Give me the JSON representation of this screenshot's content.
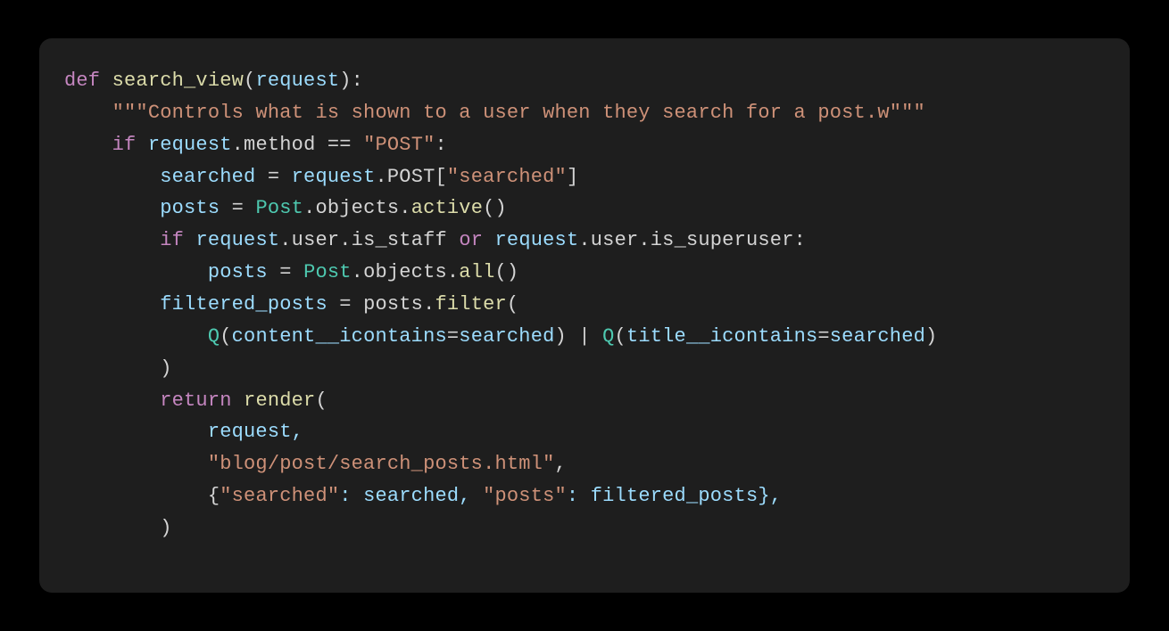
{
  "code": {
    "language": "python",
    "theme": "dark-plus",
    "tokens": [
      [
        {
          "t": "def ",
          "c": "kw"
        },
        {
          "t": "search_view",
          "c": "fn"
        },
        {
          "t": "(",
          "c": "pn"
        },
        {
          "t": "request",
          "c": "par"
        },
        {
          "t": "):",
          "c": "pn"
        }
      ],
      [
        {
          "t": "    ",
          "c": "pn"
        },
        {
          "t": "\"\"\"Controls what is shown to a user when they search for a post.w\"\"\"",
          "c": "str"
        }
      ],
      [
        {
          "t": "    ",
          "c": "pn"
        },
        {
          "t": "if ",
          "c": "kw"
        },
        {
          "t": "request",
          "c": "par"
        },
        {
          "t": ".method ",
          "c": "prop"
        },
        {
          "t": "== ",
          "c": "op"
        },
        {
          "t": "\"POST\"",
          "c": "str"
        },
        {
          "t": ":",
          "c": "pn"
        }
      ],
      [
        {
          "t": "        searched ",
          "c": "par"
        },
        {
          "t": "= ",
          "c": "op"
        },
        {
          "t": "request",
          "c": "par"
        },
        {
          "t": ".POST[",
          "c": "prop"
        },
        {
          "t": "\"searched\"",
          "c": "str"
        },
        {
          "t": "]",
          "c": "pn"
        }
      ],
      [
        {
          "t": "        posts ",
          "c": "par"
        },
        {
          "t": "= ",
          "c": "op"
        },
        {
          "t": "Post",
          "c": "cls"
        },
        {
          "t": ".objects.",
          "c": "prop"
        },
        {
          "t": "active",
          "c": "fn"
        },
        {
          "t": "()",
          "c": "pn"
        }
      ],
      [
        {
          "t": "        ",
          "c": "pn"
        },
        {
          "t": "if ",
          "c": "kw"
        },
        {
          "t": "request",
          "c": "par"
        },
        {
          "t": ".user.is_staff ",
          "c": "prop"
        },
        {
          "t": "or ",
          "c": "kw"
        },
        {
          "t": "request",
          "c": "par"
        },
        {
          "t": ".user.is_superuser:",
          "c": "prop"
        }
      ],
      [
        {
          "t": "            posts ",
          "c": "par"
        },
        {
          "t": "= ",
          "c": "op"
        },
        {
          "t": "Post",
          "c": "cls"
        },
        {
          "t": ".objects.",
          "c": "prop"
        },
        {
          "t": "all",
          "c": "fn"
        },
        {
          "t": "()",
          "c": "pn"
        }
      ],
      [
        {
          "t": "        filtered_posts ",
          "c": "par"
        },
        {
          "t": "= ",
          "c": "op"
        },
        {
          "t": "posts.",
          "c": "prop"
        },
        {
          "t": "filter",
          "c": "fn"
        },
        {
          "t": "(",
          "c": "pn"
        }
      ],
      [
        {
          "t": "            ",
          "c": "pn"
        },
        {
          "t": "Q",
          "c": "cls"
        },
        {
          "t": "(",
          "c": "pn"
        },
        {
          "t": "content__icontains",
          "c": "par"
        },
        {
          "t": "=",
          "c": "op"
        },
        {
          "t": "searched",
          "c": "par"
        },
        {
          "t": ") | ",
          "c": "pn"
        },
        {
          "t": "Q",
          "c": "cls"
        },
        {
          "t": "(",
          "c": "pn"
        },
        {
          "t": "title__icontains",
          "c": "par"
        },
        {
          "t": "=",
          "c": "op"
        },
        {
          "t": "searched",
          "c": "par"
        },
        {
          "t": ")",
          "c": "pn"
        }
      ],
      [
        {
          "t": "        )",
          "c": "pn"
        }
      ],
      [
        {
          "t": "        ",
          "c": "pn"
        },
        {
          "t": "return ",
          "c": "kw"
        },
        {
          "t": "render",
          "c": "fn"
        },
        {
          "t": "(",
          "c": "pn"
        }
      ],
      [
        {
          "t": "            request,",
          "c": "par"
        }
      ],
      [
        {
          "t": "            ",
          "c": "pn"
        },
        {
          "t": "\"blog/post/search_posts.html\"",
          "c": "str"
        },
        {
          "t": ",",
          "c": "pn"
        }
      ],
      [
        {
          "t": "            {",
          "c": "pn"
        },
        {
          "t": "\"searched\"",
          "c": "str"
        },
        {
          "t": ": searched, ",
          "c": "par"
        },
        {
          "t": "\"posts\"",
          "c": "str"
        },
        {
          "t": ": filtered_posts},",
          "c": "par"
        }
      ],
      [
        {
          "t": "        )",
          "c": "pn"
        }
      ]
    ]
  }
}
